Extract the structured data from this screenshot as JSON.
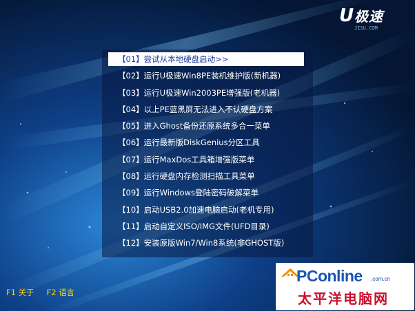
{
  "brand": {
    "logo_mark": "U",
    "logo_name": "极速",
    "logo_url": "JISU.COM"
  },
  "menu": {
    "items": [
      {
        "label": "【01】尝试从本地硬盘启动>>",
        "selected": true
      },
      {
        "label": "【02】运行U极速Win8PE装机维护版(新机器)",
        "selected": false
      },
      {
        "label": "【03】运行U极速Win2003PE增强版(老机器)",
        "selected": false
      },
      {
        "label": "【04】以上PE蓝黑屏无法进入不认硬盘方案",
        "selected": false
      },
      {
        "label": "【05】进入Ghost备份还原系统多合一菜单",
        "selected": false
      },
      {
        "label": "【06】运行最新版DiskGenius分区工具",
        "selected": false
      },
      {
        "label": "【07】运行MaxDos工具箱增强版菜单",
        "selected": false
      },
      {
        "label": "【08】运行硬盘内存检测扫描工具菜单",
        "selected": false
      },
      {
        "label": "【09】运行Windows登陆密码破解菜单",
        "selected": false
      },
      {
        "label": "【10】启动USB2.0加速电脑启动(老机专用)",
        "selected": false
      },
      {
        "label": "【11】启动自定义ISO/IMG文件(UFD目录)",
        "selected": false
      },
      {
        "label": "【12】安装原版Win7/Win8系统(非GHOST版)",
        "selected": false
      }
    ]
  },
  "footer": {
    "f1_label": "F1 关于",
    "f2_label": "F2 语言"
  },
  "watermark": {
    "brand": "PConline",
    "domain": ".com.cn",
    "chinese": "太平洋电脑网"
  },
  "colors": {
    "background": "#06204a",
    "menu_text": "#ffffff",
    "selected_bg": "#ffffff",
    "selected_text": "#1a3a9a",
    "footer_text": "#ffd700",
    "pconline_blue": "#1a55b0",
    "pconline_red": "#c8102e"
  }
}
